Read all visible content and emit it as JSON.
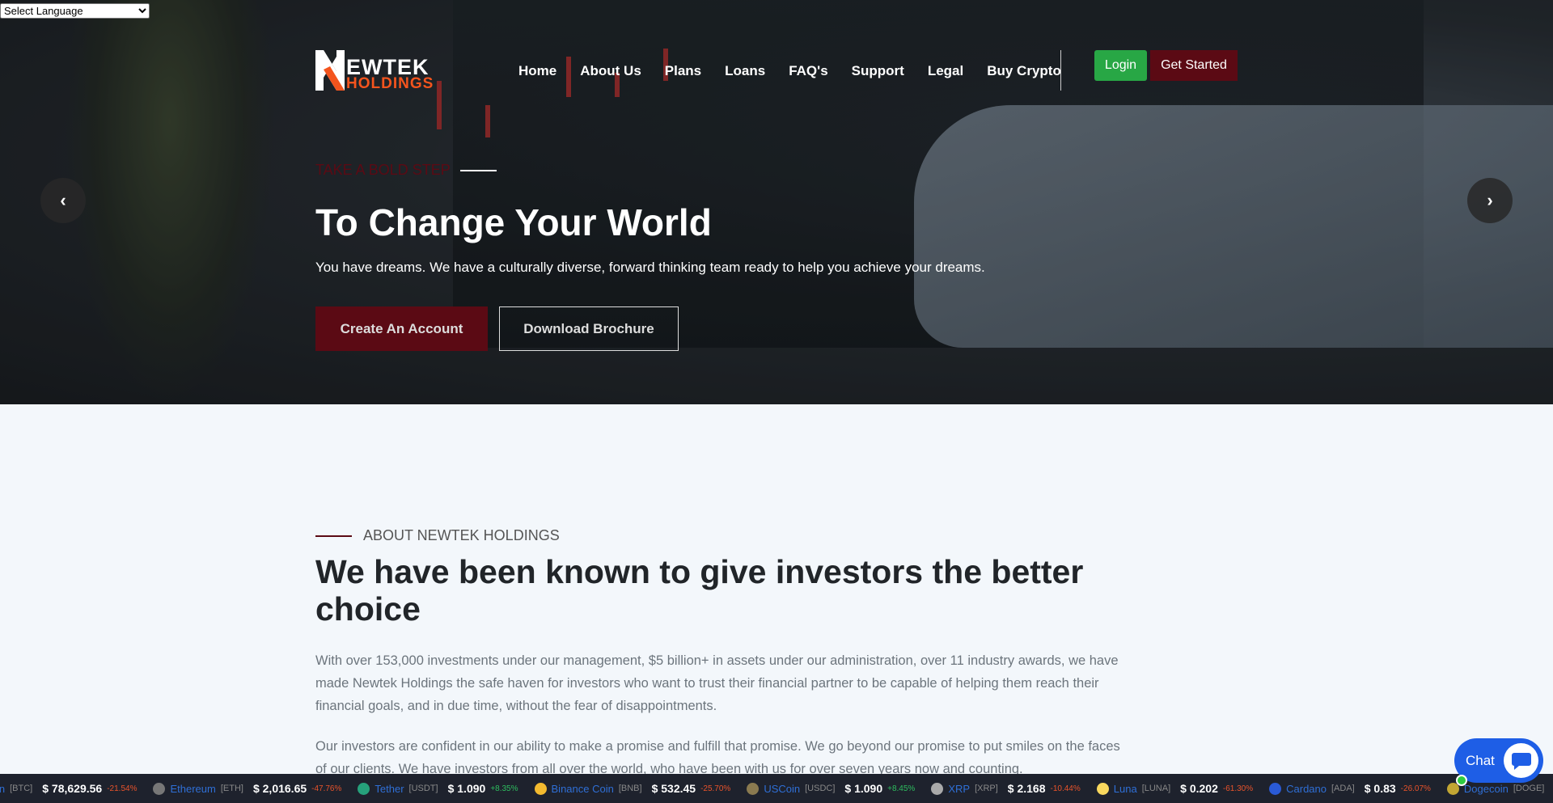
{
  "language_select": {
    "selected": "Select Language"
  },
  "logo": {
    "line1": "EWTEK",
    "line2": "HOLDINGS",
    "text": "NEWTEK HOLDINGS"
  },
  "nav": [
    "Home",
    "About Us",
    "Plans",
    "Loans",
    "FAQ's",
    "Support",
    "Legal",
    "Buy Crypto"
  ],
  "header": {
    "login": "Login",
    "get_started": "Get Started"
  },
  "hero": {
    "subtitle": "TAKE A BOLD STEP",
    "title": "To Change Your World",
    "description": "You have dreams. We have a culturally diverse, forward thinking team ready to help you achieve your dreams.",
    "create_account": "Create An Account",
    "download_brochure": "Download Brochure",
    "prev": "‹",
    "next": "›"
  },
  "about": {
    "label": "ABOUT NEWTEK HOLDINGS",
    "heading": "We have been known to give investors the better choice",
    "p1": "With over 153,000 investments under our management, $5 billion+ in assets under our administration, over 11 industry awards, we have made Newtek Holdings the safe haven for investors who want to trust their financial partner to be capable of helping them reach their financial goals, and in due time, without the fear of disappointments.",
    "p2": "Our investors are confident in our ability to make a promise and fulfill that promise. We go beyond our promise to put smiles on the faces of our clients. We have investors from all over the world, who have been with us for over seven years now and counting."
  },
  "ticker": [
    {
      "name": "in",
      "symbol": "[BTC]",
      "price": "$ 78,629.56",
      "change": "-21.54%",
      "color": "#f7931a",
      "up": false
    },
    {
      "name": "Ethereum",
      "symbol": "[ETH]",
      "price": "$ 2,016.65",
      "change": "-47.76%",
      "color": "#777777",
      "up": false
    },
    {
      "name": "Tether",
      "symbol": "[USDT]",
      "price": "$ 1.090",
      "change": "+8.35%",
      "color": "#26a17b",
      "up": true
    },
    {
      "name": "Binance Coin",
      "symbol": "[BNB]",
      "price": "$ 532.45",
      "change": "-25.70%",
      "color": "#f3ba2f",
      "up": false
    },
    {
      "name": "USCoin",
      "symbol": "[USDC]",
      "price": "$ 1.090",
      "change": "+8.45%",
      "color": "#8a7a50",
      "up": true
    },
    {
      "name": "XRP",
      "symbol": "[XRP]",
      "price": "$ 2.168",
      "change": "-10.44%",
      "color": "#aaaaaa",
      "up": false
    },
    {
      "name": "Luna",
      "symbol": "[LUNA]",
      "price": "$ 0.202",
      "change": "-61.30%",
      "color": "#f9d85e",
      "up": false
    },
    {
      "name": "Cardano",
      "symbol": "[ADA]",
      "price": "$ 0.83",
      "change": "-26.07%",
      "color": "#2a5ad6",
      "up": false
    },
    {
      "name": "Dogecoin",
      "symbol": "[DOGE]",
      "price": "$",
      "change": "",
      "color": "#c2a633",
      "up": false
    }
  ],
  "chat": {
    "label": "Chat"
  },
  "colors": {
    "brand_maroon": "#5b0a14",
    "logo_orange": "#f4541d",
    "login_green": "#28a745",
    "up": "#2ebd5f",
    "down": "#e8532b",
    "chat_blue": "#1e5ee6"
  }
}
